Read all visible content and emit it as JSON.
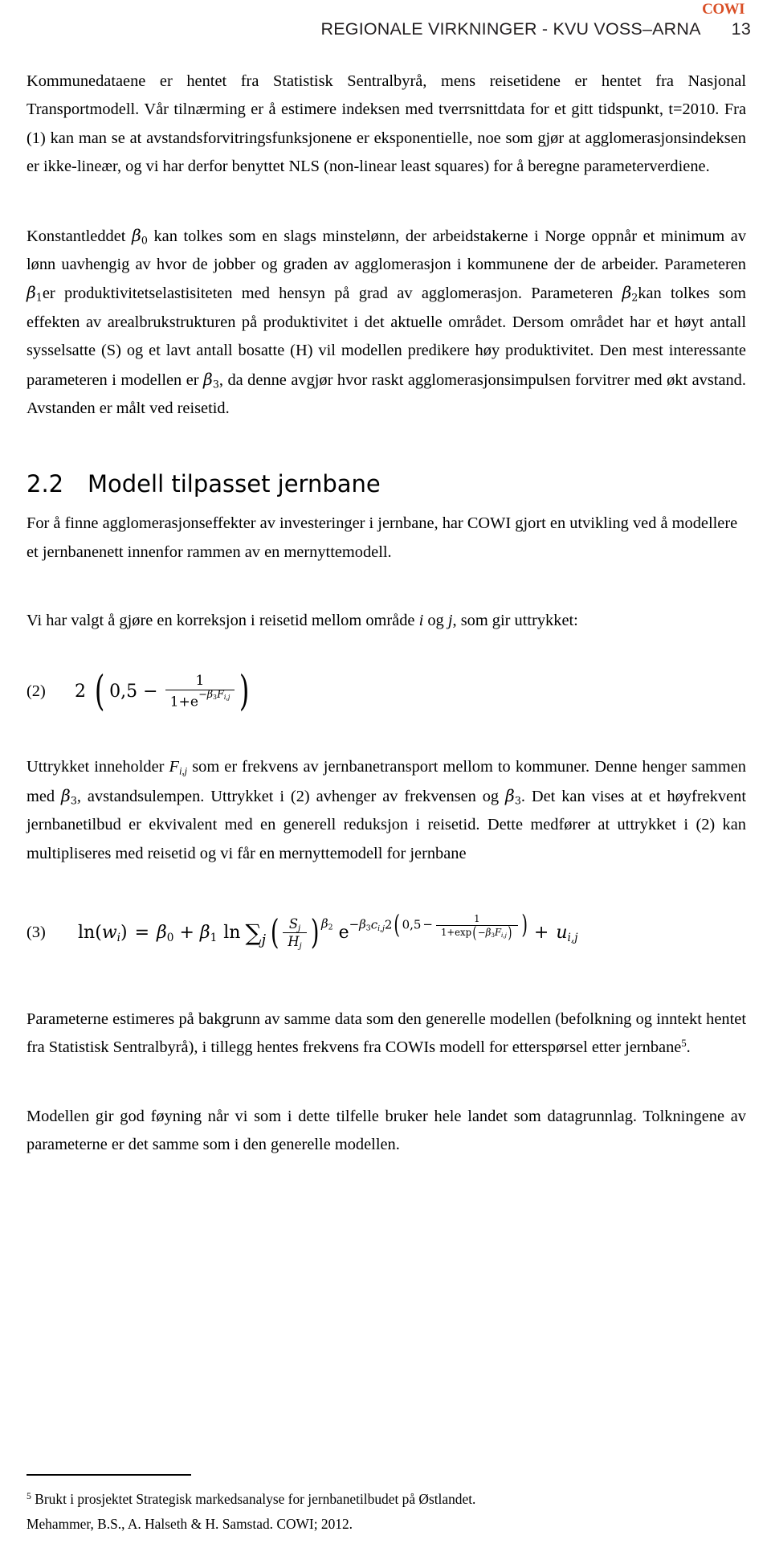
{
  "header": {
    "brand": "COWI",
    "brand_color": "#d94f26",
    "title": "REGIONALE VIRKNINGER - KVU VOSS–ARNA",
    "page_number": "13"
  },
  "paragraphs": {
    "p1": "Kommunedataene er hentet fra Statistisk Sentralbyrå, mens reisetidene er hentet fra Nasjonal Transportmodell. Vår tilnærming er å estimere indeksen med tverrsnittdata for et gitt tidspunkt, t=2010. Fra (1) kan man se at avstandsforvitringsfunksjonene er eksponentielle, noe som gjør at agglomerasjonsindeksen er ikke-lineær, og vi har derfor benyttet NLS (non-linear least squares) for å beregne parameterverdiene.",
    "p2_a": "Konstantleddet ",
    "p2_b": " kan tolkes som en slags minstelønn, der arbeidstakerne i Norge oppnår et minimum av lønn uavhengig av hvor de jobber og graden av agglomerasjon i kommunene der de arbeider. Parameteren ",
    "p2_c": "er produktivitetselastisiteten med hensyn på grad av agglomerasjon. Parameteren ",
    "p2_d": "kan tolkes som effekten av arealbrukstrukturen på produktivitet i det aktuelle området. Dersom området har et høyt antall sysselsatte (S) og et lavt antall bosatte (H) vil modellen predikere høy produktivitet. Den mest interessante parameteren i modellen er ",
    "p2_e": ", da denne avgjør hvor raskt agglomerasjonsimpulsen forvitrer med økt avstand. Avstanden er målt ved reisetid.",
    "p3": "For å finne agglomerasjonseffekter av investeringer i jernbane, har COWI gjort en utvikling ved å modellere et jernbanenett innenfor rammen av en mernyttemodell.",
    "p4_a": "Vi har valgt å gjøre en korreksjon i reisetid mellom område ",
    "p4_b": " og ",
    "p4_c": ", som gir uttrykket:",
    "p5_a": "Uttrykket inneholder ",
    "p5_b": " som er frekvens av jernbanetransport mellom to kommuner. Denne henger sammen med ",
    "p5_c": ", avstandsulempen. Uttrykket i (2) avhenger av frekvensen og ",
    "p5_d": ". Det kan vises at et høyfrekvent jernbanetilbud er ekvivalent med en generell reduksjon i reisetid. Dette medfører at uttrykket i (2) kan multipliseres med reisetid og vi får en mernyttemodell for jernbane",
    "p6": "Parameterne estimeres på bakgrunn av samme data som den generelle modellen (befolkning og inntekt hentet fra Statistisk Sentralbyrå), i tillegg hentes frekvens fra COWIs modell for etterspørsel etter jernbane",
    "p6_sup": "5",
    "p6_end": ".",
    "p7": "Modellen gir god føyning når vi som i dette tilfelle bruker hele landet som datagrunnlag. Tolkningene av parameterne er det samme som i den generelle modellen."
  },
  "heading": {
    "number": "2.2",
    "text": "Modell tilpasset jernbane"
  },
  "symbols": {
    "beta": "β",
    "beta0_sub": "0",
    "beta1_sub": "1",
    "beta2_sub": "2",
    "beta3_sub": "3",
    "i": "i",
    "j": "j",
    "S": "S",
    "H": "H",
    "F": "F",
    "c": "c",
    "w": "w",
    "u": "u",
    "e": "e",
    "sum": "∑",
    "ln": "ln",
    "exp": "exp",
    "equals": "=",
    "plus": "+",
    "minus": "−",
    "subscript_ij": "i,j"
  },
  "equations": {
    "eq2": {
      "number": "(2)",
      "leading_coefficient": "2",
      "constant": "0,5",
      "operator": "−",
      "numerator": "1",
      "denominator_prefix": "1+e",
      "exponent": "−β₃Fᵢ,ⱼ",
      "plain": "2 (0,5 − 1/(1+e^(−β3F_i,j))"
    },
    "eq3": {
      "number": "(3)",
      "lhs": "ln(wᵢ)",
      "plain": "ln(w_i) = β0 + β1 ln ∑_j (S_j/H_j)^β2 e^(−β3 c_i,j 2(0,5 − 1/(1+exp(−β3 F_i,j)))) + u_i,j",
      "constant": "0,5",
      "numerator": "1",
      "denominator": "1+exp",
      "tail_plus": "+"
    }
  },
  "footnote": {
    "marker": "5",
    "line1": "Brukt i prosjektet Strategisk markedsanalyse for jernbanetilbudet på Østlandet.",
    "line2": "Mehammer, B.S., A. Halseth & H. Samstad. COWI; 2012."
  }
}
